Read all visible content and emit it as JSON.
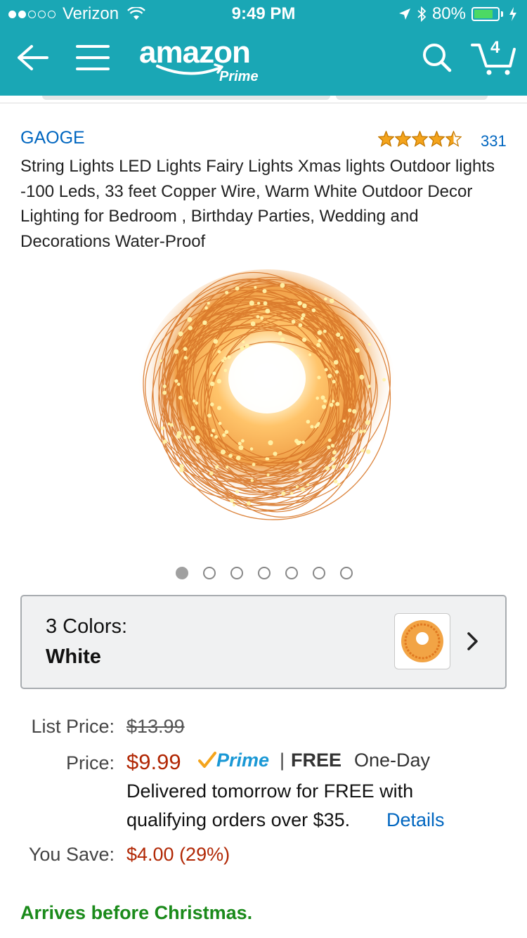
{
  "status_bar": {
    "carrier": "Verizon",
    "time": "9:49 PM",
    "battery_percent": "80%",
    "battery_level": 0.8,
    "signal_bars_filled": 2,
    "signal_bars_total": 5
  },
  "nav": {
    "logo_text": "amazon",
    "logo_subtext": "Prime",
    "cart_count": "4"
  },
  "product": {
    "brand": "GAOGE",
    "rating_stars": 4.5,
    "rating_count": "331",
    "title": "String Lights LED Lights Fairy Lights Xmas lights Outdoor lights -100 Leds, 33 feet Copper Wire, Warm White Outdoor Decor Lighting for Bedroom , Birthday Parties, Wedding and Decorations Water-Proof",
    "image_count": 7,
    "image_active_index": 0
  },
  "variation": {
    "count_label": "3 Colors:",
    "selected": "White"
  },
  "pricing": {
    "list_price_label": "List Price:",
    "list_price": "$13.99",
    "price_label": "Price:",
    "price": "$9.99",
    "prime_badge": "Prime",
    "separator": "|",
    "free_label": "FREE",
    "shipping_speed": "One-Day",
    "delivery_line1": "Delivered tomorrow for FREE with",
    "delivery_line2": "qualifying orders over $35.",
    "details_link": "Details",
    "you_save_label": "You Save:",
    "you_save": "$4.00 (29%)"
  },
  "arrival_message": "Arrives before Christmas.",
  "colors": {
    "header_teal": "#1aa7b5",
    "link_blue": "#0066c0",
    "price_red": "#b12704",
    "arrival_green": "#1a8a1a",
    "star_gold": "#f4a41c"
  }
}
